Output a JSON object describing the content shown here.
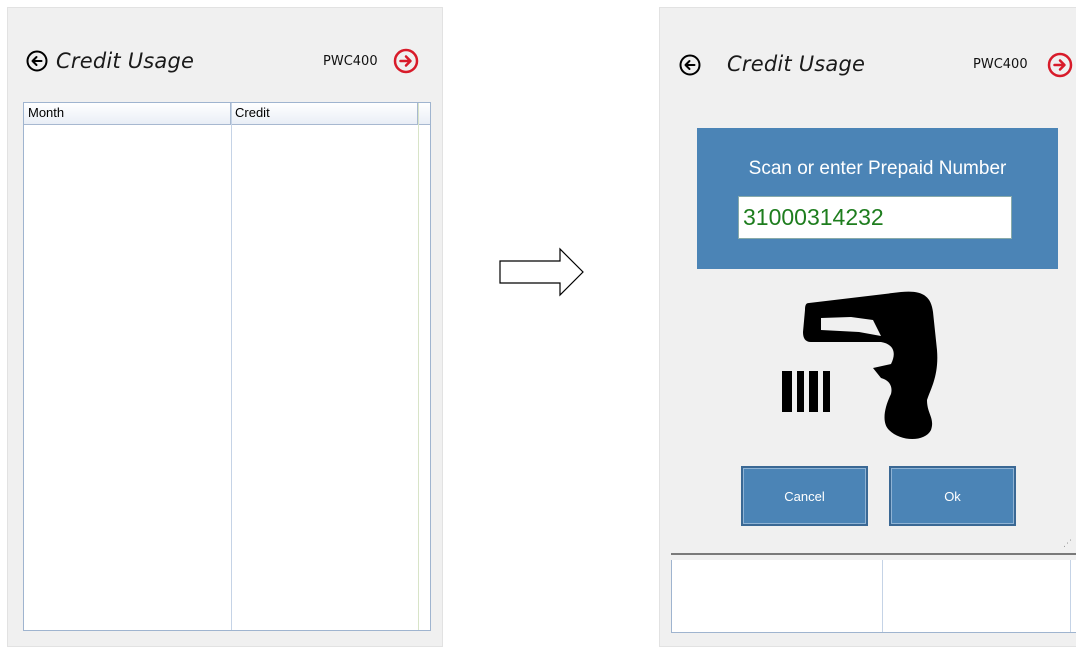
{
  "left_screen": {
    "title": "Credit Usage",
    "device_code": "PWC400",
    "table": {
      "columns": [
        "Month",
        "Credit"
      ],
      "rows": []
    }
  },
  "right_screen": {
    "title": "Credit Usage",
    "device_code": "PWC400",
    "dialog": {
      "prompt": "Scan or enter Prepaid Number",
      "prepaid_number": "31000314232",
      "cancel_label": "Cancel",
      "ok_label": "Ok"
    }
  },
  "colors": {
    "accent_blue": "#4b84b6",
    "forward_red": "#d81b2a",
    "input_text_green": "#1e7d1e"
  },
  "icons": {
    "back": "circle-arrow-left-icon",
    "forward": "circle-arrow-right-icon",
    "scanner": "barcode-scanner-icon",
    "transition": "right-arrow-icon"
  }
}
